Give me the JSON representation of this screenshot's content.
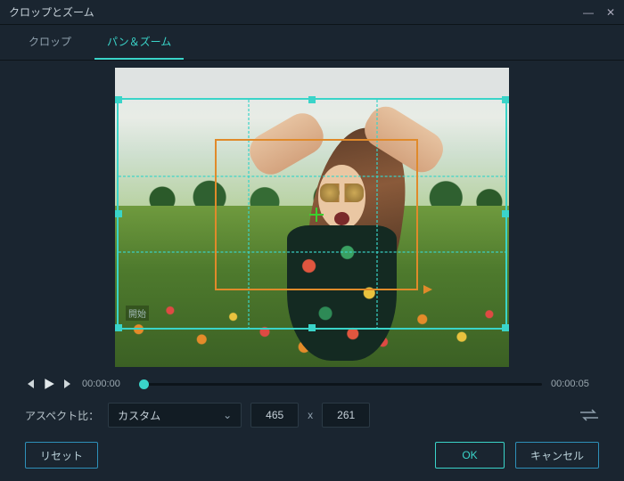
{
  "window": {
    "title": "クロップとズーム"
  },
  "tabs": {
    "crop": "クロップ",
    "panzoom": "パン＆ズーム"
  },
  "badges": {
    "start": "開始"
  },
  "playback": {
    "current": "00:00:00",
    "duration": "00:00:05"
  },
  "aspect": {
    "label": "アスペクト比：",
    "selected": "カスタム",
    "width": "465",
    "sep": "x",
    "height": "261"
  },
  "footer": {
    "reset": "リセット",
    "ok": "OK",
    "cancel": "キャンセル"
  }
}
